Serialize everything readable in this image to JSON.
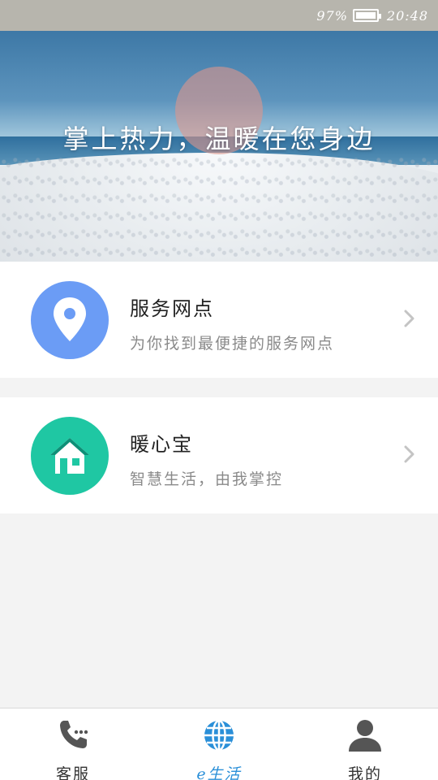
{
  "status_bar": {
    "battery": "97%",
    "time": "20:48"
  },
  "banner": {
    "slogan": "掌上热力，温暖在您身边"
  },
  "cards": [
    {
      "title": "服务网点",
      "subtitle": "为你找到最便捷的服务网点",
      "icon": "location-pin-icon",
      "icon_color": "#6b9cf5"
    },
    {
      "title": "暖心宝",
      "subtitle": "智慧生活，由我掌控",
      "icon": "house-icon",
      "icon_color": "#1fc7a3"
    }
  ],
  "bottom_nav": {
    "items": [
      {
        "label": "客服",
        "icon": "phone-icon"
      },
      {
        "label": "e生活",
        "icon": "globe-icon",
        "active": true
      },
      {
        "label": "我的",
        "icon": "person-icon"
      }
    ]
  },
  "colors": {
    "accent": "#2a8fd8",
    "status_bar": "#b7b5ad"
  }
}
